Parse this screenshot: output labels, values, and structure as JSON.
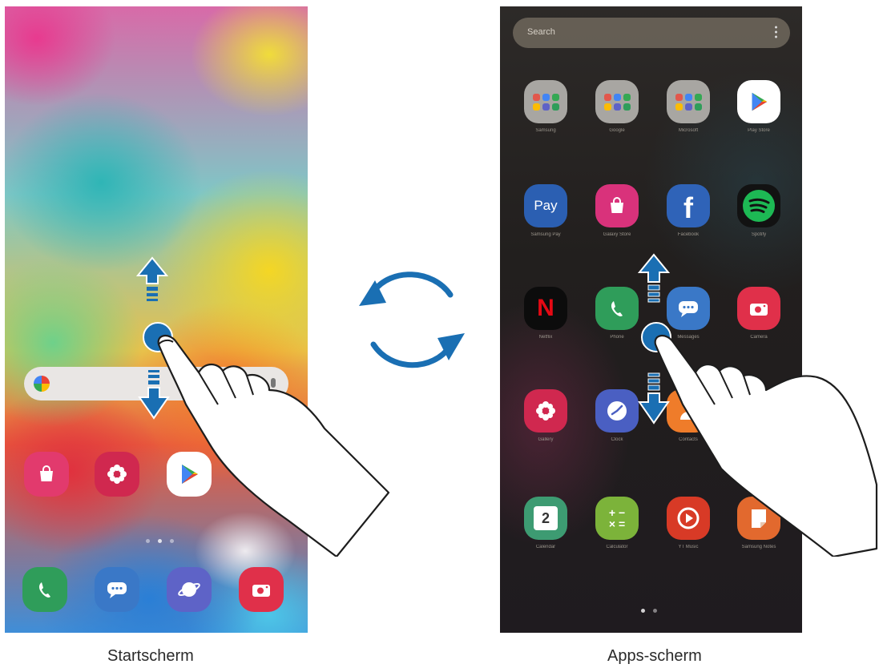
{
  "captions": {
    "home": "Startscherm",
    "apps": "Apps-scherm"
  },
  "colors": {
    "accent_arrow": "#1a6fb3",
    "pill_bg": "#e9e6e4"
  },
  "home_screen": {
    "search_pill": {
      "icon": "google-g-icon",
      "mic_icon": "mic-icon"
    },
    "row_apps": [
      {
        "name": "galaxy-store",
        "icon": "shopping-bag-icon",
        "color": "#e23a6d"
      },
      {
        "name": "gallery",
        "icon": "flower-icon",
        "color": "#d0284f"
      },
      {
        "name": "play-store",
        "icon": "play-triangle-icon",
        "color": "#ffffff"
      }
    ],
    "dock": [
      {
        "name": "phone",
        "icon": "phone-handset-icon",
        "color": "#2f9d5a"
      },
      {
        "name": "messages",
        "icon": "chat-bubble-icon",
        "color": "#3a78c7"
      },
      {
        "name": "internet",
        "icon": "planet-icon",
        "color": "#5e63c7"
      },
      {
        "name": "camera",
        "icon": "camera-icon",
        "color": "#e0304a"
      }
    ]
  },
  "apps_screen": {
    "search": {
      "placeholder": "Search"
    },
    "apps": [
      {
        "name": "Samsung",
        "icon": "folder-icon",
        "color": "#a8a6a2"
      },
      {
        "name": "Google",
        "icon": "folder-icon",
        "color": "#a8a6a2"
      },
      {
        "name": "Microsoft",
        "icon": "folder-icon",
        "color": "#a8a6a2"
      },
      {
        "name": "Play Store",
        "icon": "play-triangle-icon",
        "color": "#ffffff"
      },
      {
        "name": "Samsung Pay",
        "icon": "pay-icon",
        "color": "#2b5fb2",
        "text": "Pay"
      },
      {
        "name": "Galaxy Store",
        "icon": "shopping-bag-icon",
        "color": "#d9327b"
      },
      {
        "name": "Facebook",
        "icon": "facebook-f-icon",
        "color": "#2f63b8",
        "text": "f"
      },
      {
        "name": "Spotify",
        "icon": "spotify-icon",
        "color": "#121212"
      },
      {
        "name": "Netflix",
        "icon": "netflix-icon",
        "color": "#0c0c0c",
        "text": "N"
      },
      {
        "name": "Phone",
        "icon": "phone-handset-icon",
        "color": "#2f9d5a"
      },
      {
        "name": "Messages",
        "icon": "chat-bubble-icon",
        "color": "#3a78c7"
      },
      {
        "name": "Camera",
        "icon": "camera-icon",
        "color": "#e0304a"
      },
      {
        "name": "Gallery",
        "icon": "flower-icon",
        "color": "#d0284f"
      },
      {
        "name": "Clock",
        "icon": "clock-icon",
        "color": "#4a5fc2"
      },
      {
        "name": "Contacts",
        "icon": "person-icon",
        "color": "#ef7c2a"
      },
      {
        "name": "",
        "icon": "blank-icon",
        "color": "transparent"
      },
      {
        "name": "Calendar",
        "icon": "calendar-icon",
        "color": "#3d9b72",
        "text": "2"
      },
      {
        "name": "Calculator",
        "icon": "calculator-icon",
        "color": "#7cb33a"
      },
      {
        "name": "YT Music",
        "icon": "play-circle-icon",
        "color": "#d83a26"
      },
      {
        "name": "Samsung Notes",
        "icon": "notes-icon",
        "color": "#e2692e"
      }
    ]
  }
}
